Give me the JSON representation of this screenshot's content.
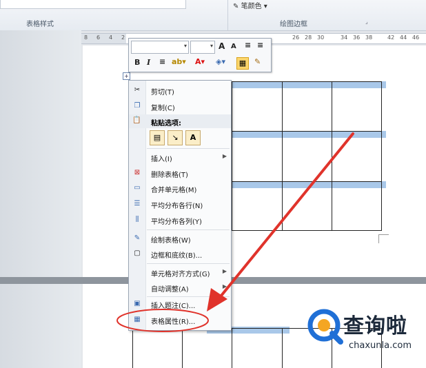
{
  "ribbon": {
    "group1": "表格样式",
    "group2": "绘图边框",
    "pen_color": "笔颜色"
  },
  "ruler": {
    "numbers": [
      "8",
      "6",
      "4",
      "2",
      "26",
      "28",
      "30",
      "34",
      "36",
      "38",
      "42",
      "44",
      "46"
    ]
  },
  "mini_toolbar": {
    "bold": "B",
    "italic": "I",
    "grow_font": "A",
    "shrink_font": "A"
  },
  "context_menu": {
    "cut": "剪切(T)",
    "copy": "复制(C)",
    "paste_options": "粘贴选项:",
    "insert": "插入(I)",
    "delete_table": "删除表格(T)",
    "merge_cells": "合并单元格(M)",
    "distribute_rows": "平均分布各行(N)",
    "distribute_cols": "平均分布各列(Y)",
    "draw_table": "绘制表格(W)",
    "borders_shading": "边框和底纹(B)...",
    "cell_alignment": "单元格对齐方式(G)",
    "autofit": "自动调整(A)",
    "insert_caption": "插入题注(C)...",
    "table_properties": "表格属性(R)..."
  },
  "watermark": {
    "brand": "查询啦",
    "domain": "chaxunla.com"
  },
  "colors": {
    "highlight": "#a9c8e9",
    "annotation_red": "#e0332b"
  }
}
